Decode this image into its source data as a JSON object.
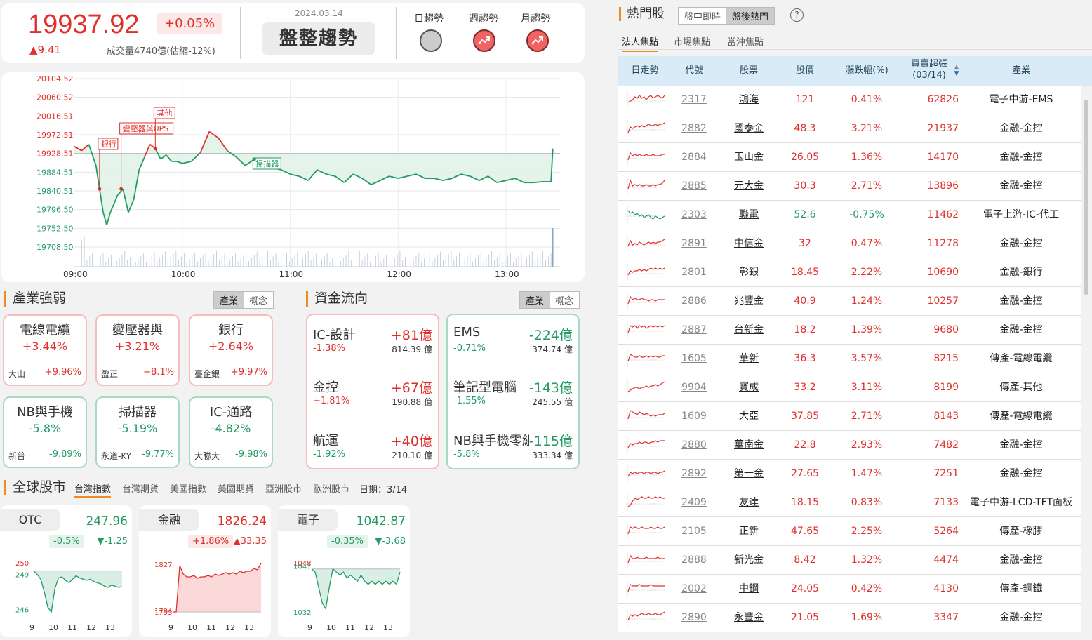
{
  "index": {
    "value": "19937.92",
    "pct": "+0.05%",
    "change": "▲9.41",
    "volume": "成交量4740億(估縮-12%)",
    "trend_date": "2024.03.14",
    "trend_label": "盤整趨勢",
    "trends": [
      {
        "label": "日趨勢",
        "icon": "flat-circle-icon",
        "state": "flat"
      },
      {
        "label": "週趨勢",
        "icon": "trend-up-icon",
        "state": "up"
      },
      {
        "label": "月趨勢",
        "icon": "trend-up-icon",
        "state": "up"
      }
    ]
  },
  "chart_data": {
    "type": "line",
    "y_ticks": [
      "20104.52",
      "20060.52",
      "20016.51",
      "19972.51",
      "19928.51",
      "19884.51",
      "19840.51",
      "19796.50",
      "19752.50",
      "19708.50"
    ],
    "x_ticks": [
      "09:00",
      "10:00",
      "11:00",
      "12:00",
      "13:00"
    ],
    "reference": 19928.51,
    "ylim": [
      19708.5,
      20104.52
    ],
    "series": [
      {
        "x_minutes": [
          0,
          4,
          8,
          12,
          14,
          16,
          18,
          20,
          22,
          24,
          27,
          30,
          33,
          36,
          39,
          42,
          45,
          48,
          51,
          54,
          57,
          60,
          65,
          70,
          75,
          80,
          85,
          90,
          95,
          100,
          105,
          110,
          115,
          120,
          125,
          130,
          135,
          140,
          145,
          150,
          155,
          160,
          165,
          170,
          175,
          180,
          185,
          190,
          195,
          200,
          205,
          210,
          215,
          220,
          225,
          230,
          235,
          240,
          245,
          250,
          255,
          260,
          265,
          266
        ],
        "values": [
          19945,
          19935,
          19950,
          19900,
          19845,
          19790,
          19760,
          19790,
          19810,
          19830,
          19845,
          19790,
          19820,
          19890,
          19920,
          19950,
          19940,
          19915,
          19925,
          19910,
          19910,
          19905,
          19910,
          19930,
          19980,
          19965,
          19935,
          19920,
          19900,
          19915,
          19895,
          19895,
          19890,
          19880,
          19875,
          19865,
          19890,
          19880,
          19875,
          19860,
          19880,
          19870,
          19855,
          19865,
          19875,
          19870,
          19875,
          19880,
          19870,
          19870,
          19865,
          19870,
          19880,
          19875,
          19865,
          19875,
          19860,
          19865,
          19870,
          19860,
          19860,
          19862,
          19862,
          19940
        ]
      }
    ],
    "annotations": [
      {
        "label": "銀行",
        "time": 14
      },
      {
        "label": "變壓器與UPS",
        "time": 26
      },
      {
        "label": "其他",
        "time": 45
      },
      {
        "label": "掃描器",
        "time": 100
      }
    ]
  },
  "industry": {
    "title": "產業強弱",
    "seg": [
      "產業",
      "概念"
    ],
    "cards": [
      {
        "name": "電線電纜",
        "pct": "+3.44%",
        "stock": "大山",
        "stock_pct": "+9.96%",
        "dir": "up"
      },
      {
        "name": "變壓器與",
        "pct": "+3.21%",
        "stock": "盈正",
        "stock_pct": "+8.1%",
        "dir": "up"
      },
      {
        "name": "銀行",
        "pct": "+2.64%",
        "stock": "臺企銀",
        "stock_pct": "+9.97%",
        "dir": "up"
      },
      {
        "name": "NB與手機",
        "pct": "-5.8%",
        "stock": "新普",
        "stock_pct": "-9.89%",
        "dir": "dn"
      },
      {
        "name": "掃描器",
        "pct": "-5.19%",
        "stock": "永道-KY",
        "stock_pct": "-9.77%",
        "dir": "dn"
      },
      {
        "name": "IC-通路",
        "pct": "-4.82%",
        "stock": "大聯大",
        "stock_pct": "-9.98%",
        "dir": "dn"
      }
    ]
  },
  "flow": {
    "title": "資金流向",
    "seg": [
      "產業",
      "概念"
    ],
    "inflow": [
      {
        "name": "IC-設計",
        "amount": "+81億",
        "pct": "-1.38%",
        "total": "814.39 億"
      },
      {
        "name": "金控",
        "amount": "+67億",
        "pct": "+1.81%",
        "total": "190.88 億"
      },
      {
        "name": "航運",
        "amount": "+40億",
        "pct": "-1.92%",
        "total": "210.10 億"
      }
    ],
    "outflow": [
      {
        "name": "EMS",
        "amount": "-224億",
        "pct": "-0.71%",
        "total": "374.74 億"
      },
      {
        "name": "筆記型電腦",
        "amount": "-143億",
        "pct": "-1.55%",
        "total": "245.55 億"
      },
      {
        "name": "NB與手機零組件",
        "amount": "-115億",
        "pct": "-5.8%",
        "total": "333.34 億"
      }
    ]
  },
  "global": {
    "title": "全球股市",
    "tabs": [
      "台灣指數",
      "台灣期貨",
      "美國指數",
      "美國期貨",
      "亞洲股市",
      "歐洲股市"
    ],
    "date": "日期：3/14",
    "x_ticks": [
      "9",
      "10",
      "11",
      "12",
      "13"
    ],
    "cards": [
      {
        "name": "OTC",
        "value": "247.96",
        "pct": "-0.5%",
        "change": "▼-1.25",
        "dir": "dn",
        "y_ticks": [
          "250",
          "249",
          "246"
        ],
        "values": [
          249.3,
          249.0,
          248.6,
          247.5,
          246.2,
          245.8,
          247.8,
          248.7,
          248.8,
          248.5,
          248.3,
          248.6,
          248.9,
          248.7,
          248.6,
          248.5,
          248.6,
          248.4,
          248.3,
          248.2,
          248.0,
          247.9,
          248.1,
          248.0,
          247.9,
          247.95
        ]
      },
      {
        "name": "金融",
        "value": "1826.24",
        "pct": "+1.86%",
        "change": "▲33.35",
        "dir": "up",
        "y_ticks": [
          "1827",
          "1794",
          "1793"
        ],
        "values": [
          1793,
          1793,
          1826,
          1820,
          1818,
          1818,
          1819,
          1817,
          1818,
          1818,
          1819,
          1818,
          1820,
          1819,
          1820,
          1821,
          1820,
          1821,
          1820,
          1822,
          1821,
          1822,
          1822,
          1824,
          1823,
          1828
        ]
      },
      {
        "name": "電子",
        "value": "1042.87",
        "pct": "-0.35%",
        "change": "▼-3.68",
        "dir": "dn",
        "y_ticks": [
          "1048",
          "1047",
          "1032"
        ],
        "values": [
          1046,
          1045,
          1040,
          1035,
          1033,
          1040,
          1046,
          1045,
          1044,
          1045,
          1043,
          1044,
          1043,
          1042,
          1044,
          1042,
          1041,
          1042,
          1041,
          1042,
          1041,
          1042,
          1041,
          1042,
          1041,
          1045
        ]
      }
    ]
  },
  "hot": {
    "title": "熱門股",
    "seg": [
      "盤中即時",
      "盤後熱門"
    ],
    "help_icon": "?",
    "tabs": [
      "法人焦點",
      "市場焦點",
      "當沖焦點"
    ],
    "columns": [
      "日走勢",
      "代號",
      "股票",
      "股價",
      "漲跌幅(%)",
      "買賣超張",
      "(03/14)",
      "產業"
    ],
    "sort_icon": "sort-arrows-icon",
    "rows": [
      {
        "code": "2317",
        "name": "鴻海",
        "price": "121",
        "pct": "0.41%",
        "net": "62826",
        "industry": "電子中游-EMS",
        "dir": "up",
        "spark": [
          3,
          4,
          5,
          7,
          6,
          8,
          6,
          7,
          5,
          7,
          8,
          6,
          7,
          8,
          7,
          6,
          8
        ]
      },
      {
        "code": "2882",
        "name": "國泰金",
        "price": "48.3",
        "pct": "3.21%",
        "net": "21937",
        "industry": "金融-金控",
        "dir": "up",
        "spark": [
          2,
          6,
          5,
          6,
          7,
          6,
          7,
          6,
          7,
          8,
          7,
          7,
          8,
          7,
          8,
          8,
          9
        ]
      },
      {
        "code": "2884",
        "name": "玉山金",
        "price": "26.05",
        "pct": "1.36%",
        "net": "14170",
        "industry": "金融-金控",
        "dir": "up",
        "spark": [
          3,
          8,
          6,
          7,
          6,
          7,
          6,
          6,
          7,
          6,
          6,
          7,
          6,
          6,
          6,
          7,
          7
        ]
      },
      {
        "code": "2885",
        "name": "元大金",
        "price": "30.3",
        "pct": "2.71%",
        "net": "13896",
        "industry": "金融-金控",
        "dir": "up",
        "spark": [
          3,
          9,
          5,
          6,
          5,
          6,
          5,
          5,
          6,
          5,
          5,
          6,
          5,
          6,
          6,
          7,
          9
        ]
      },
      {
        "code": "2303",
        "name": "聯電",
        "price": "52.6",
        "pct": "-0.75%",
        "net": "11462",
        "industry": "電子上游-IC-代工",
        "dir": "dn",
        "spark": [
          8,
          6,
          7,
          5,
          6,
          4,
          5,
          3,
          4,
          5,
          3,
          2,
          4,
          3,
          2,
          3,
          4
        ]
      },
      {
        "code": "2891",
        "name": "中信金",
        "price": "32",
        "pct": "0.47%",
        "net": "11278",
        "industry": "金融-金控",
        "dir": "up",
        "spark": [
          3,
          7,
          4,
          5,
          4,
          6,
          5,
          4,
          5,
          6,
          5,
          6,
          5,
          6,
          6,
          7,
          8
        ]
      },
      {
        "code": "2801",
        "name": "彰銀",
        "price": "18.45",
        "pct": "2.22%",
        "net": "10690",
        "industry": "金融-銀行",
        "dir": "up",
        "spark": [
          3,
          6,
          5,
          6,
          6,
          7,
          6,
          7,
          6,
          7,
          8,
          7,
          8,
          7,
          8,
          7,
          8
        ]
      },
      {
        "code": "2886",
        "name": "兆豐金",
        "price": "40.9",
        "pct": "1.24%",
        "net": "10257",
        "industry": "金融-金控",
        "dir": "up",
        "spark": [
          3,
          8,
          6,
          7,
          6,
          6,
          7,
          6,
          6,
          5,
          6,
          6,
          5,
          6,
          6,
          6,
          6
        ]
      },
      {
        "code": "2887",
        "name": "台新金",
        "price": "18.2",
        "pct": "1.39%",
        "net": "9680",
        "industry": "金融-金控",
        "dir": "up",
        "spark": [
          3,
          8,
          7,
          8,
          6,
          8,
          7,
          8,
          6,
          7,
          8,
          7,
          8,
          7,
          8,
          7,
          8
        ]
      },
      {
        "code": "1605",
        "name": "華新",
        "price": "36.3",
        "pct": "3.57%",
        "net": "8215",
        "industry": "傳產-電線電纜",
        "dir": "up",
        "spark": [
          3,
          8,
          7,
          6,
          6,
          7,
          6,
          6,
          7,
          6,
          7,
          6,
          7,
          6,
          6,
          7,
          7
        ]
      },
      {
        "code": "9904",
        "name": "寶成",
        "price": "33.2",
        "pct": "3.11%",
        "net": "8199",
        "industry": "傳產-其他",
        "dir": "up",
        "spark": [
          2,
          3,
          4,
          5,
          5,
          4,
          5,
          5,
          6,
          5,
          6,
          6,
          7,
          6,
          7,
          8,
          9
        ]
      },
      {
        "code": "1609",
        "name": "大亞",
        "price": "37.85",
        "pct": "2.71%",
        "net": "8143",
        "industry": "傳產-電線電纜",
        "dir": "up",
        "spark": [
          3,
          9,
          8,
          7,
          6,
          8,
          7,
          6,
          7,
          6,
          5,
          6,
          5,
          6,
          6,
          6,
          7
        ]
      },
      {
        "code": "2880",
        "name": "華南金",
        "price": "22.8",
        "pct": "2.93%",
        "net": "7482",
        "industry": "金融-金控",
        "dir": "up",
        "spark": [
          3,
          6,
          5,
          6,
          6,
          7,
          6,
          7,
          7,
          6,
          7,
          7,
          8,
          7,
          8,
          8,
          8
        ]
      },
      {
        "code": "2892",
        "name": "第一金",
        "price": "27.65",
        "pct": "1.47%",
        "net": "7251",
        "industry": "金融-金控",
        "dir": "up",
        "spark": [
          3,
          6,
          5,
          6,
          5,
          6,
          6,
          5,
          6,
          6,
          5,
          6,
          6,
          5,
          6,
          6,
          7
        ]
      },
      {
        "code": "2409",
        "name": "友達",
        "price": "18.15",
        "pct": "0.83%",
        "net": "7133",
        "industry": "電子中游-LCD-TFT面板",
        "dir": "up",
        "spark": [
          2,
          3,
          6,
          8,
          7,
          8,
          9,
          8,
          8,
          9,
          8,
          8,
          9,
          8,
          9,
          8,
          8
        ]
      },
      {
        "code": "2105",
        "name": "正新",
        "price": "47.65",
        "pct": "2.25%",
        "net": "5264",
        "industry": "傳產-橡膠",
        "dir": "up",
        "spark": [
          3,
          8,
          7,
          8,
          7,
          7,
          8,
          7,
          7,
          7,
          8,
          7,
          7,
          8,
          7,
          7,
          8
        ]
      },
      {
        "code": "2888",
        "name": "新光金",
        "price": "8.42",
        "pct": "1.32%",
        "net": "4474",
        "industry": "金融-金控",
        "dir": "up",
        "spark": [
          3,
          8,
          6,
          6,
          7,
          6,
          6,
          6,
          7,
          6,
          6,
          6,
          6,
          7,
          6,
          6,
          6
        ]
      },
      {
        "code": "2002",
        "name": "中鋼",
        "price": "24.05",
        "pct": "0.42%",
        "net": "4130",
        "industry": "傳產-鋼鐵",
        "dir": "up",
        "spark": [
          3,
          8,
          7,
          7,
          7,
          8,
          7,
          7,
          7,
          7,
          8,
          7,
          7,
          7,
          7,
          7,
          7
        ]
      },
      {
        "code": "2890",
        "name": "永豐金",
        "price": "21.05",
        "pct": "1.69%",
        "net": "3347",
        "industry": "金融-金控",
        "dir": "up",
        "spark": [
          3,
          7,
          6,
          7,
          6,
          7,
          8,
          7,
          7,
          8,
          7,
          7,
          8,
          7,
          7,
          8,
          9
        ]
      }
    ]
  }
}
